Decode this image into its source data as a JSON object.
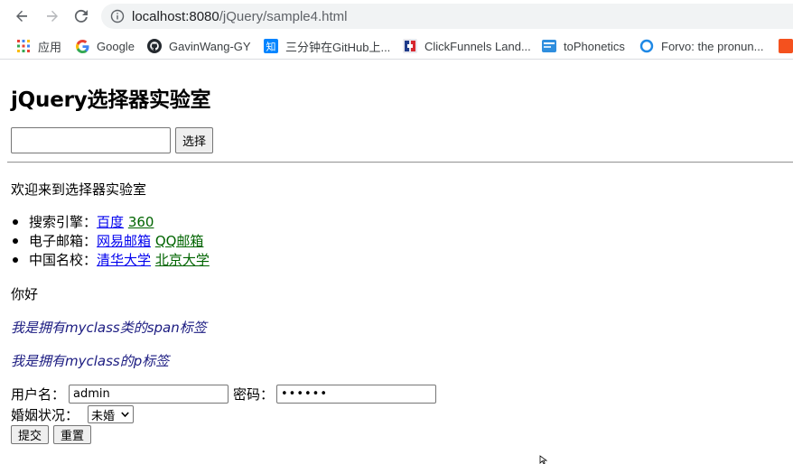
{
  "browser": {
    "url_host": "localhost:8080",
    "url_path": "/jQuery/sample4.html",
    "bookmarks": [
      {
        "label": "应用",
        "icon": "apps-grid-icon"
      },
      {
        "label": "Google",
        "icon": "google-icon"
      },
      {
        "label": "GavinWang-GY",
        "icon": "github-icon"
      },
      {
        "label": "三分钟在GitHub上...",
        "icon": "zhihu-icon"
      },
      {
        "label": "ClickFunnels Land...",
        "icon": "clickfunnels-icon"
      },
      {
        "label": "toPhonetics",
        "icon": "tophonetics-icon"
      },
      {
        "label": "Forvo: the pronun...",
        "icon": "forvo-icon"
      }
    ],
    "colors": {
      "omnibox": "#f1f3f4",
      "link_blue": "#0000ee",
      "link_green": "#006400"
    }
  },
  "page": {
    "title": "jQuery选择器实验室",
    "select_button": "选择",
    "welcome": "欢迎来到选择器实验室",
    "link_groups": [
      {
        "label": "搜索引擎：",
        "links": [
          {
            "text": "百度",
            "color": "blue"
          },
          {
            "text": "360",
            "color": "green"
          }
        ]
      },
      {
        "label": "电子邮箱：",
        "links": [
          {
            "text": "网易邮箱",
            "color": "blue"
          },
          {
            "text": "QQ邮箱",
            "color": "green"
          }
        ]
      },
      {
        "label": "中国名校：",
        "links": [
          {
            "text": "清华大学",
            "color": "blue"
          },
          {
            "text": "北京大学",
            "color": "green"
          }
        ]
      }
    ],
    "greeting": "你好",
    "span_text": "我是拥有myclass类的span标签",
    "p_text": "我是拥有myclass的p标签",
    "form": {
      "username_label": "用户名：",
      "username_value": "admin",
      "password_label": "密码：",
      "password_value": "••••••",
      "marital_label": "婚姻状况：",
      "marital_selected": "未婚",
      "submit_label": "提交",
      "reset_label": "重置"
    }
  }
}
